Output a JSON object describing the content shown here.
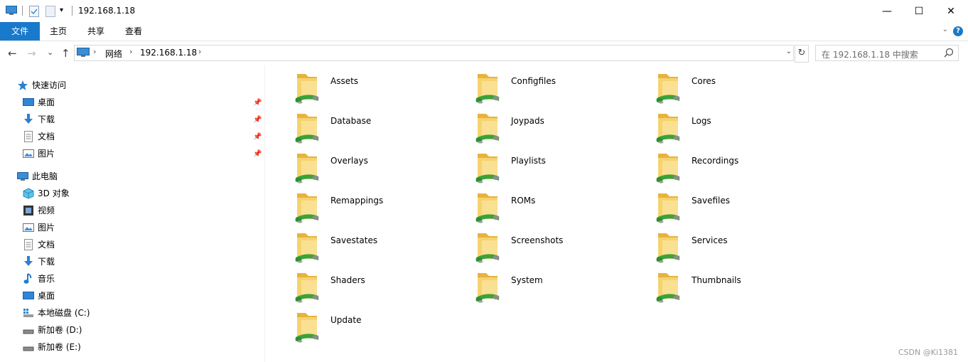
{
  "titlebar": {
    "title": "192.168.1.18",
    "minimize_label": "—",
    "maximize_label": "☐",
    "close_label": "✕"
  },
  "ribbon": {
    "tabs": [
      "文件",
      "主页",
      "共享",
      "查看"
    ],
    "help_label": "?"
  },
  "navigation": {
    "back_label": "←",
    "forward_label": "→",
    "recent_label": "⌄",
    "up_label": "↑",
    "breadcrumbs": [
      "网络",
      "192.168.1.18"
    ],
    "refresh_label": "↻"
  },
  "search": {
    "placeholder": "在 192.168.1.18 中搜索"
  },
  "sidebar": {
    "quick_access_label": "快速访问",
    "quick_access_items": [
      "桌面",
      "下载",
      "文档",
      "图片"
    ],
    "this_pc_label": "此电脑",
    "this_pc_items": [
      "3D 对象",
      "视频",
      "图片",
      "文档",
      "下载",
      "音乐",
      "桌面",
      "本地磁盘 (C:)",
      "新加卷 (D:)",
      "新加卷 (E:)"
    ]
  },
  "folders": [
    [
      "Assets",
      "Configfiles",
      "Cores"
    ],
    [
      "Database",
      "Joypads",
      "Logs"
    ],
    [
      "Overlays",
      "Playlists",
      "Recordings"
    ],
    [
      "Remappings",
      "ROMs",
      "Savefiles"
    ],
    [
      "Savestates",
      "Screenshots",
      "Services"
    ],
    [
      "Shaders",
      "System",
      "Thumbnails"
    ],
    [
      "Update"
    ]
  ],
  "watermark": "CSDN @Ki1381",
  "colors": {
    "accent": "#1979ca",
    "folder": "#f3c955",
    "share_arrow": "#3aa33a"
  }
}
